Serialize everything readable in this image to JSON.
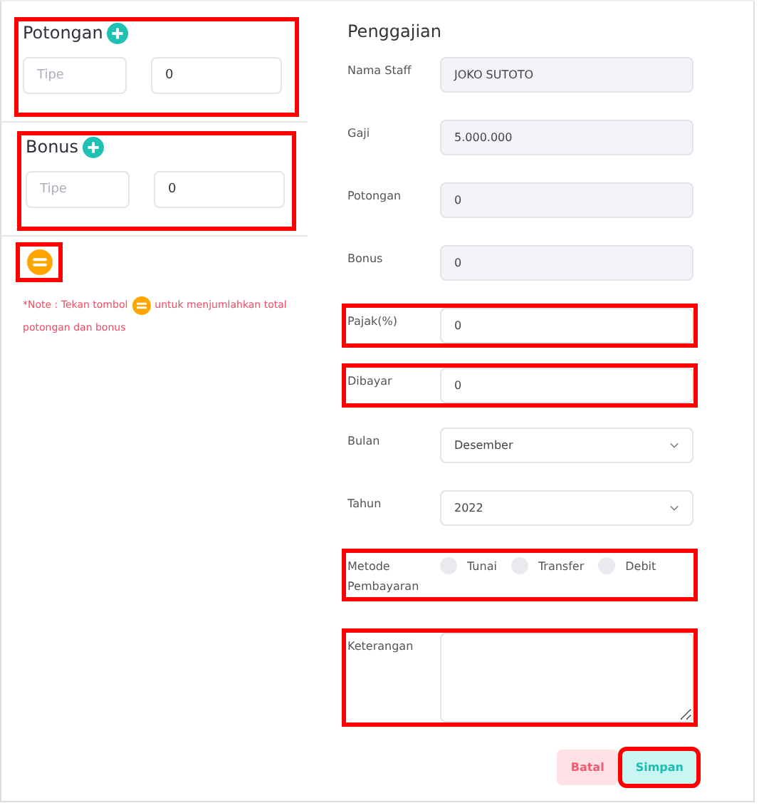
{
  "sections": [
    {
      "title": "Potongan",
      "highlighted": true,
      "type_placeholder": "Tipe",
      "amount": "0"
    },
    {
      "title": "Bonus",
      "highlighted": true,
      "type_placeholder": "Tipe",
      "amount": "0"
    }
  ],
  "sum_button": {
    "highlighted": true
  },
  "note": {
    "before": "*Note : Tekan tombol",
    "after": "untuk menjumlahkan total",
    "continued": "potongan dan bonus"
  },
  "form": {
    "title": "Penggajian",
    "fields": [
      {
        "label": "Nama Staff",
        "kind": "readonly",
        "value": "JOKO SUTOTO",
        "highlighted": false
      },
      {
        "label": "Gaji",
        "kind": "readonly",
        "value": "5.000.000",
        "highlighted": false
      },
      {
        "label": "Potongan",
        "kind": "readonly",
        "value": "0",
        "highlighted": false
      },
      {
        "label": "Bonus",
        "kind": "readonly",
        "value": "0",
        "highlighted": false
      },
      {
        "label": "Pajak(%)",
        "kind": "input",
        "value": "0",
        "highlighted": true
      },
      {
        "label": "Dibayar",
        "kind": "input",
        "value": "0",
        "highlighted": true
      },
      {
        "label": "Bulan",
        "kind": "select",
        "value": "Desember",
        "highlighted": false
      },
      {
        "label": "Tahun",
        "kind": "select",
        "value": "2022",
        "highlighted": false
      },
      {
        "label": "Metode Pembayaran",
        "kind": "radio",
        "highlighted": true,
        "options": [
          {
            "label": "Tunai",
            "selected": false
          },
          {
            "label": "Transfer",
            "selected": false
          },
          {
            "label": "Debit",
            "selected": false
          }
        ]
      },
      {
        "label": "Keterangan",
        "kind": "textarea",
        "highlighted": true
      }
    ],
    "buttons": [
      {
        "label": "Batal",
        "kind": "cancel",
        "highlighted": false
      },
      {
        "label": "Simpan",
        "kind": "save",
        "highlighted": true
      }
    ]
  }
}
